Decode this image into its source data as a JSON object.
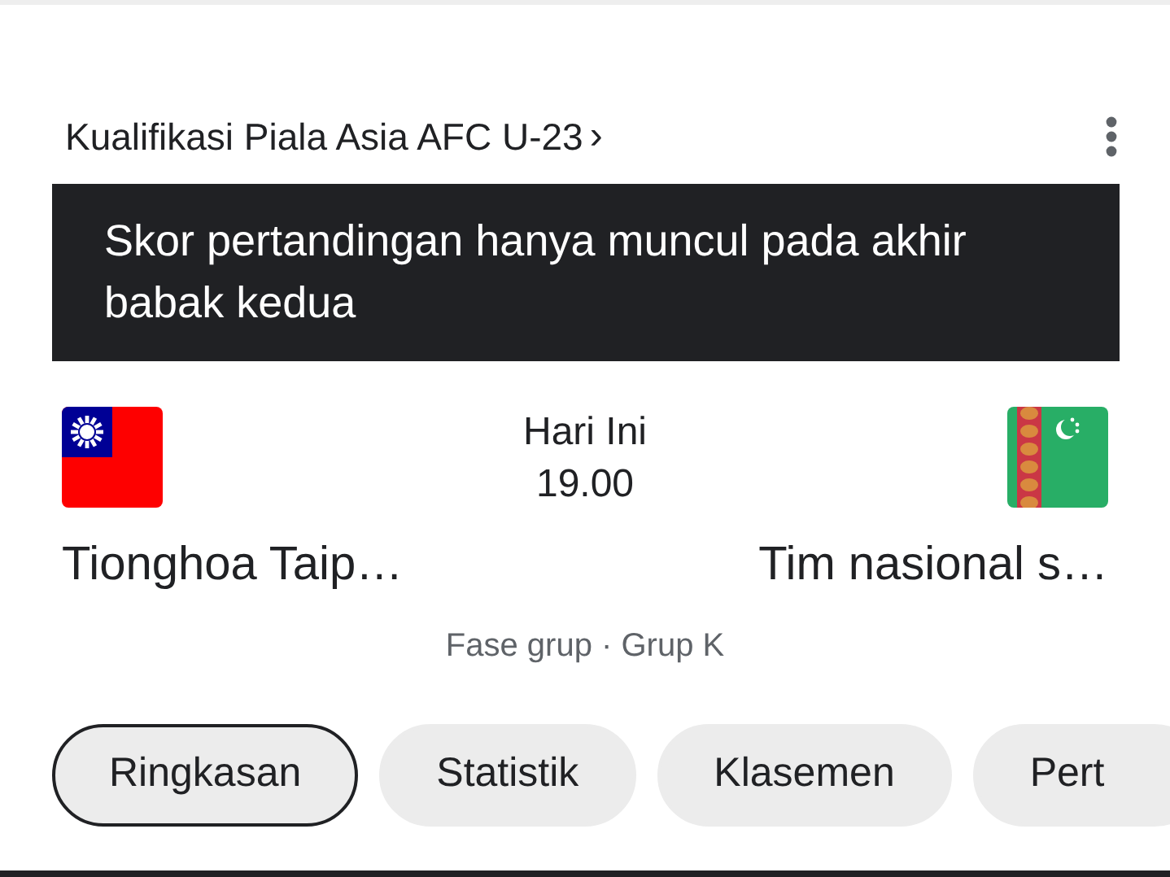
{
  "header": {
    "title": "Kualifikasi Piala Asia AFC U-23",
    "chevron": "›"
  },
  "notice": "Skor pertandingan hanya muncul pada akhir babak kedua",
  "match": {
    "home": {
      "kind": "taiwan",
      "name": "Tionghoa Taip…"
    },
    "day": "Hari Ini",
    "time": "19.00",
    "away": {
      "kind": "turkmenistan",
      "name": "Tim nasional s…"
    },
    "stage": "Fase grup · Grup K"
  },
  "tabs": [
    {
      "label": "Ringkasan",
      "selected": true
    },
    {
      "label": "Statistik",
      "selected": false
    },
    {
      "label": "Klasemen",
      "selected": false
    },
    {
      "label": "Pert",
      "selected": false
    }
  ]
}
